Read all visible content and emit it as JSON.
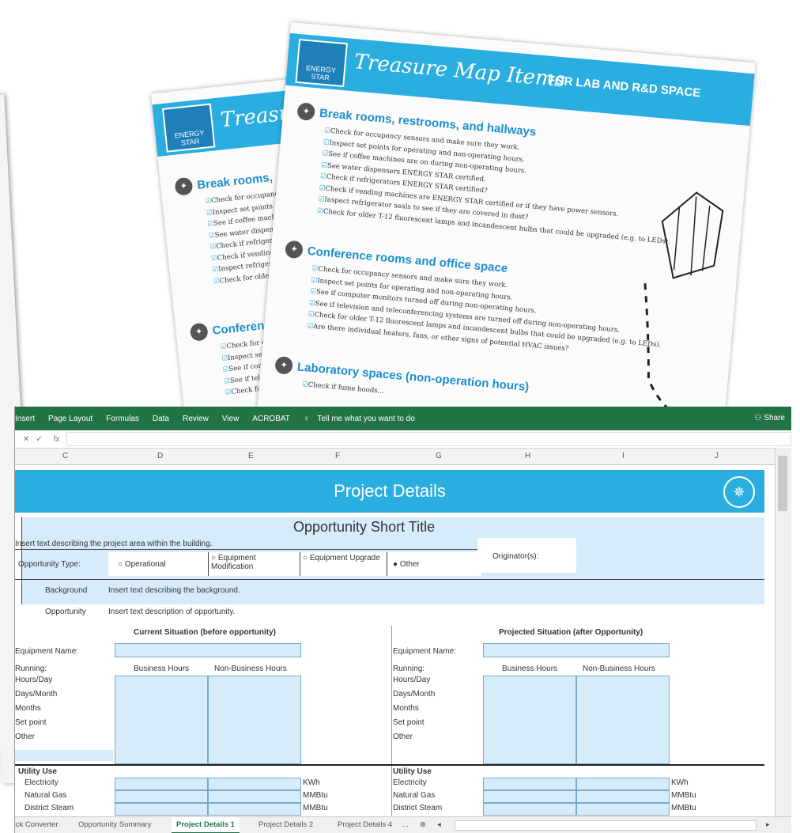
{
  "back_sheet": {
    "logo_label": "ENERGY STAR",
    "title": "Treasu",
    "section1_title": "Break rooms,",
    "section1_items": [
      "Check for occupancy",
      "Inspect set points",
      "See if coffee machines",
      "See water dispensers",
      "Check if refrigerators",
      "Check if vending",
      "Inspect refrigerators",
      "Check for older"
    ],
    "section2_title": "Conference",
    "section2_items": [
      "Check for occupancy",
      "Inspect set points",
      "See if computer",
      "See if television",
      "Check for older"
    ]
  },
  "front_sheet": {
    "logo_label": "ENERGY STAR",
    "title": "Treasure Map Items",
    "subtitle": "FOR LAB AND R&D SPACE",
    "section1_title": "Break rooms, restrooms, and hallways",
    "section1_items": [
      "Check for occupancy sensors and make sure they work.",
      "Inspect set points for operating and non-operating hours.",
      "See if coffee machines are on during non-operating hours.",
      "See water dispensers ENERGY STAR certified.",
      "Check if refrigerators ENERGY STAR certified?",
      "Check if vending machines are ENERGY STAR certified or if they have power sensors.",
      "Inspect refrigerator seals to see if they are covered in dust?",
      "Check for older T-12 fluorescent lamps and incandescent bulbs that could be upgraded (e.g. to LEDs)."
    ],
    "section2_title": "Conference rooms and office space",
    "section2_items": [
      "Check for occupancy sensors and make sure they work.",
      "Inspect set points for operating and non-operating hours.",
      "See if computer monitors turned off during non-operating hours.",
      "See if television and teleconferencing systems are turned off during non-operating hours.",
      "Check for older T-12 fluorescent lamps and incandescent bulbs that could be upgraded (e.g. to LEDs).",
      "Are there individual heaters, fans, or other signs of potential HVAC issues?"
    ],
    "section3_title": "Laboratory spaces (non-operation hours)",
    "section3_items": [
      "Check if fume hoods..."
    ]
  },
  "excel": {
    "ribbon_tabs": [
      "Insert",
      "Page Layout",
      "Formulas",
      "Data",
      "Review",
      "View",
      "ACROBAT"
    ],
    "tell_me": "Tell me what you want to do",
    "share": "Share",
    "fx_label": "fx",
    "columns": [
      "C",
      "D",
      "E",
      "F",
      "G",
      "H",
      "I",
      "J"
    ],
    "banner_title": "Project Details",
    "short_title": "Opportunity Short Title",
    "area_text": "Insert text describing the project area within the building.",
    "opp_type_label": "Opportunity Type:",
    "opp_options": [
      "Operational",
      "Equipment Modification",
      "Equipment Upgrade",
      "Other"
    ],
    "originator_label": "Originator(s):",
    "background_label": "Background",
    "background_text": "Insert text describing the background.",
    "opportunity_label": "Opportunity",
    "opportunity_text": "Insert text description of opportunity.",
    "current_header": "Current Situation (before opportunity)",
    "projected_header": "Projected Situation (after Opportunity)",
    "equip_name_left": "Equipment Name:",
    "equip_name_right": "Equipment Name:",
    "running_left": "Running:",
    "running_right": "Running:",
    "business_hours": "Business Hours",
    "non_business_hours": "Non-Business Hours",
    "rows_left": [
      "Hours/Day",
      "Days/Month",
      "Months",
      "Set point",
      "Other"
    ],
    "rows_right": [
      "Hours/Day",
      "Days/Month",
      "Months",
      "Set point",
      "Other"
    ],
    "utility_use": "Utility Use",
    "utilities": [
      "Electricity",
      "Natural Gas",
      "District Steam"
    ],
    "units": [
      "KWh",
      "MMBtu",
      "MMBtu"
    ],
    "sheet_tabs": [
      "Quick Converter",
      "Opportunity Summary",
      "Project Details 1",
      "Project Details 2",
      "Project Details 4",
      "..."
    ],
    "active_tab": "Project Details 1"
  }
}
